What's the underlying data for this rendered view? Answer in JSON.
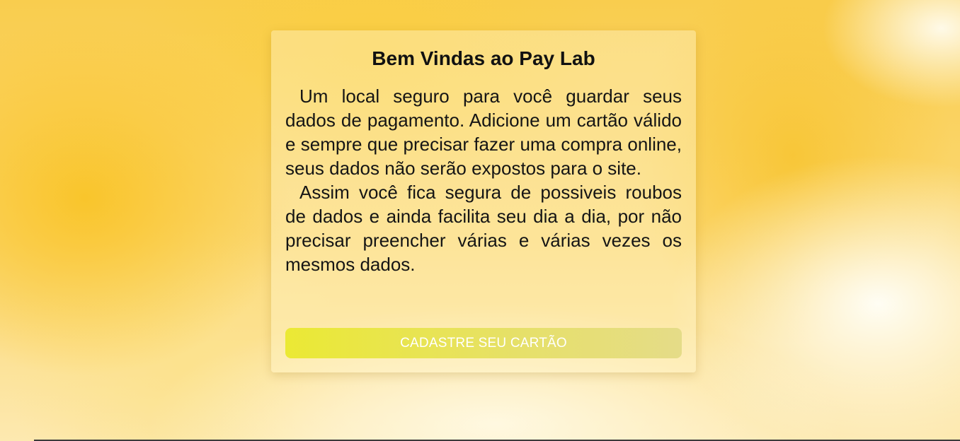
{
  "card": {
    "title": "Bem Vindas ao Pay Lab",
    "paragraphs": [
      "Um local seguro para você guardar seus dados de pagamento. Adicione um cartão válido e sempre que precisar fazer uma compra online, seus dados não serão expostos para o site.",
      "Assim você fica segura de possiveis roubos de dados e ainda facilita seu dia a dia, por não precisar preencher várias e várias vezes os mesmos dados."
    ],
    "button_label": "CADASTRE SEU CARTÃO"
  },
  "colors": {
    "background_primary": "#f9cd4e",
    "button_start": "#ebe934",
    "button_end": "#e5dc88",
    "button_text": "#ffffff"
  }
}
